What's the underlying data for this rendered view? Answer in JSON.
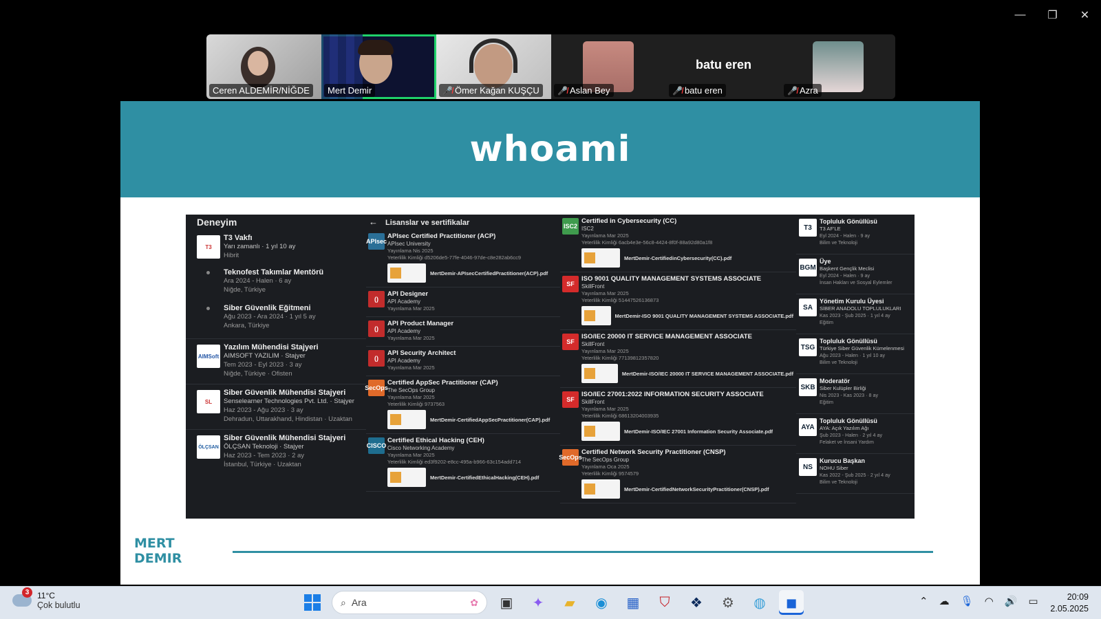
{
  "window": {
    "minimize": "—",
    "restore": "❐",
    "close": "✕"
  },
  "participants": [
    {
      "name": "Ceren ALDEMİR/NİĞDE",
      "muted": false,
      "active": false
    },
    {
      "name": "Mert Demir",
      "muted": false,
      "active": true
    },
    {
      "name": "Ömer Kağan KUŞÇU",
      "muted": true,
      "active": false
    },
    {
      "name": "Aslan Bey",
      "muted": true,
      "active": false
    },
    {
      "name": "batu eren",
      "muted": true,
      "active": false,
      "display_name": "batu eren"
    },
    {
      "name": "Azra",
      "muted": true,
      "active": false
    }
  ],
  "slide": {
    "title": "whoami",
    "footer_name_line1": "MERT",
    "footer_name_line2": "DEMIR",
    "experience": {
      "heading": "Deneyim",
      "items": [
        {
          "logo": "T3",
          "title": "T3 Vakfı",
          "subtitle": "Yarı zamanlı · 1 yıl 10 ay",
          "meta": "Hibrit",
          "roles": [
            {
              "title": "Teknofest Takımlar Mentörü",
              "date": "Ara 2024 - Halen · 6 ay",
              "location": "Niğde, Türkiye"
            },
            {
              "title": "Siber Güvenlik Eğitmeni",
              "date": "Ağu 2023 - Ara 2024 · 1 yıl 5 ay",
              "location": "Ankara, Türkiye"
            }
          ]
        },
        {
          "logo": "AIMSoft",
          "title": "Yazılım Mühendisi Stajyeri",
          "subtitle": "AIMSOFT YAZILIM · Stajyer",
          "date": "Tem 2023 - Eyl 2023 · 3 ay",
          "meta": "Niğde, Türkiye · Ofisten"
        },
        {
          "logo": "SL",
          "title": "Siber Güvenlik Mühendisi Stajyeri",
          "subtitle": "Senselearner Technologies Pvt. Ltd. · Stajyer",
          "date": "Haz 2023 - Ağu 2023 · 3 ay",
          "meta": "Dehradun, Uttarakhand, Hindistan · Uzaktan"
        },
        {
          "logo": "ÖLÇSAN",
          "title": "Siber Güvenlik Mühendisi Stajyeri",
          "subtitle": "ÖLÇSAN Teknoloji · Stajyer",
          "date": "Haz 2023 - Tem 2023 · 2 ay",
          "meta": "İstanbul, Türkiye · Uzaktan"
        }
      ]
    },
    "licenses": {
      "heading": "Lisanslar ve sertifikalar",
      "back_icon": "←",
      "items": [
        {
          "logo": "APIsec",
          "logo_color": "#2a6f97",
          "title": "APIsec Certified Practitioner (ACP)",
          "issuer": "APIsec University",
          "date": "Yayınlama Nis 2025",
          "credential": "Yeterlilik Kimliği d5206de5-77fe-4046-97de-c8e282ab6cc9",
          "pdf": "MertDemir-APIsecCertifiedPractitioner(ACP).pdf"
        },
        {
          "logo": "()",
          "logo_color": "#c22c2c",
          "title": "API Designer",
          "issuer": "API Academy",
          "date": "Yayınlama Mar 2025"
        },
        {
          "logo": "()",
          "logo_color": "#c22c2c",
          "title": "API Product Manager",
          "issuer": "API Academy",
          "date": "Yayınlama Mar 2025"
        },
        {
          "logo": "()",
          "logo_color": "#c22c2c",
          "title": "API Security Architect",
          "issuer": "API Academy",
          "date": "Yayınlama Mar 2025"
        },
        {
          "logo": "SecOps",
          "logo_color": "#e06a2a",
          "title": "Certified AppSec Practitioner (CAP)",
          "issuer": "The SecOps Group",
          "date": "Yayınlama Mar 2025",
          "credential": "Yeterlilik Kimliği 9737563",
          "pdf": "MertDemir-CertifiedAppSecPractitioner(CAP).pdf"
        },
        {
          "logo": "CISCO",
          "logo_color": "#1e6d8f",
          "title": "Certified Ethical Hacking (CEH)",
          "issuer": "Cisco Networking Academy",
          "date": "Yayınlama Mar 2025",
          "credential": "Yeterlilik Kimliği ed3f9202-e8cc-495a-b966-63c154add714",
          "pdf": "MertDemir-CertifiedEthicalHacking(CEH).pdf"
        }
      ]
    },
    "certs2": {
      "items": [
        {
          "logo": "ISC2",
          "logo_color": "#3f9b4d",
          "title": "Certified in Cybersecurity (CC)",
          "issuer": "ISC2",
          "date": "Yayınlama Mar 2025",
          "credential": "Yeterlilik Kimliği 6acb4e3e-56c8-4424-8f0f-88a92d80a1f8",
          "pdf": "MertDemir-CertifiedinCybersecurity(CC).pdf"
        },
        {
          "logo": "SF",
          "logo_color": "#d42b2b",
          "title": "ISO 9001 QUALITY MANAGEMENT SYSTEMS ASSOCIATE",
          "issuer": "SkillFront",
          "date": "Yayınlama Mar 2025",
          "credential": "Yeterlilik Kimliği 51447526136873",
          "pdf": "MertDemir-ISO 9001 QUALITY MANAGEMENT SYSTEMS ASSOCIATE.pdf"
        },
        {
          "logo": "SF",
          "logo_color": "#d42b2b",
          "title": "ISO/IEC 20000 IT SERVICE MANAGEMENT ASSOCIATE",
          "issuer": "SkillFront",
          "date": "Yayınlama Mar 2025",
          "credential": "Yeterlilik Kimliği 77139812357820",
          "pdf": "MertDemir-ISO/IEC 20000 IT SERVICE MANAGEMENT ASSOCIATE.pdf"
        },
        {
          "logo": "SF",
          "logo_color": "#d42b2b",
          "title": "ISO/IEC 27001:2022 INFORMATION SECURITY ASSOCIATE",
          "issuer": "SkillFront",
          "date": "Yayınlama Mar 2025",
          "credential": "Yeterlilik Kimliği 68613204003935",
          "pdf": "MertDemir-ISO/IEC 27001 Information Security Associate.pdf"
        },
        {
          "logo": "SecOps",
          "logo_color": "#e06a2a",
          "title": "Certified Network Security Practitioner (CNSP)",
          "issuer": "The SecOps Group",
          "date": "Yayınlama Oca 2025",
          "credential": "Yeterlilik Kimliği 9574579",
          "pdf": "MertDemir-CertifiedNetworkSecurityPractitioner(CNSP).pdf"
        }
      ]
    },
    "volunteer": {
      "items": [
        {
          "logo": "T3",
          "title": "Topluluk Gönüllüsü",
          "org": "T3 AF'LE",
          "date": "Eyl 2024 - Halen · 9 ay",
          "cat": "Bilim ve Teknoloji"
        },
        {
          "logo": "BGM",
          "title": "Üye",
          "org": "Başkent Gençlik Meclisi",
          "date": "Eyl 2024 - Halen · 9 ay",
          "cat": "İnsan Hakları ve Sosyal Eylemler"
        },
        {
          "logo": "SA",
          "title": "Yönetim Kurulu Üyesi",
          "org": "SİBER ANADOLU TOPLULUKLARI",
          "date": "Kas 2023 - Şub 2025 · 1 yıl 4 ay",
          "cat": "Eğitim"
        },
        {
          "logo": "TSG",
          "title": "Topluluk Gönüllüsü",
          "org": "Türkiye Siber Güvenlik Kümelenmesi",
          "date": "Ağu 2023 - Halen · 1 yıl 10 ay",
          "cat": "Bilim ve Teknoloji"
        },
        {
          "logo": "SKB",
          "title": "Moderatör",
          "org": "Siber Kulüpler Birliği",
          "date": "Nis 2023 - Kas 2023 · 8 ay",
          "cat": "Eğitim"
        },
        {
          "logo": "AYA",
          "title": "Topluluk Gönüllüsü",
          "org": "AYA: Açık Yazılım Ağı",
          "date": "Şub 2023 - Halen · 2 yıl 4 ay",
          "cat": "Felaket ve İnsani Yardım"
        },
        {
          "logo": "NS",
          "title": "Kurucu Başkan",
          "org": "NOHU Siber",
          "date": "Kas 2022 - Şub 2025 · 2 yıl 4 ay",
          "cat": "Bilim ve Teknoloji"
        }
      ]
    }
  },
  "taskbar": {
    "weather_badge": "3",
    "temp": "11°C",
    "condition": "Çok bulutlu",
    "search_placeholder": "Ara",
    "time": "20:09",
    "date": "2.05.2025",
    "apps": [
      "task-view-icon",
      "copilot-icon",
      "file-explorer-icon",
      "edge-icon",
      "store-icon",
      "mcafee-icon",
      "dropbox-icon",
      "settings-icon",
      "browser-icon",
      "zoom-icon"
    ],
    "tray": [
      "chevron-up-icon",
      "onedrive-icon",
      "microphone-icon",
      "wifi-icon",
      "volume-icon",
      "battery-icon"
    ]
  }
}
